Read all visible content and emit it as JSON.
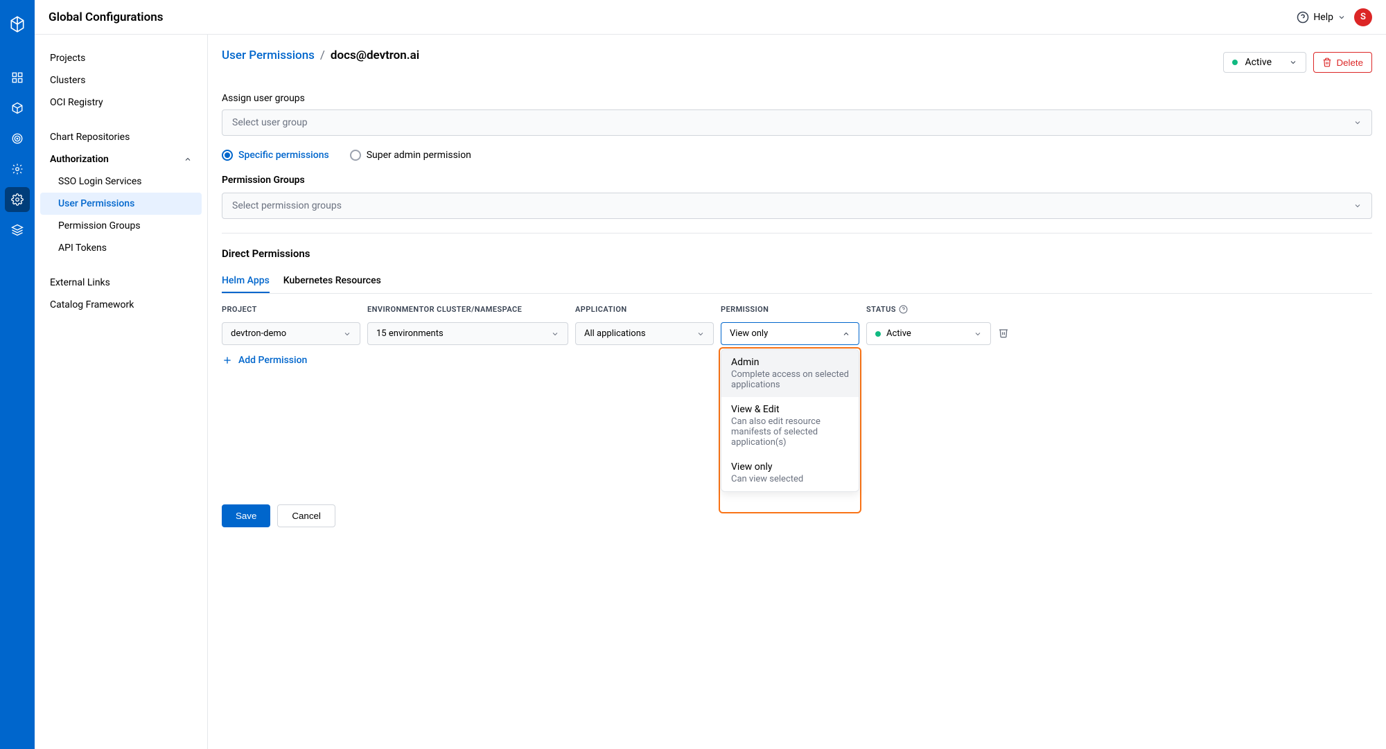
{
  "topbar": {
    "title": "Global Configurations",
    "help": "Help",
    "avatar": "S"
  },
  "sidebar": {
    "items": [
      {
        "label": "Projects"
      },
      {
        "label": "Clusters"
      },
      {
        "label": "OCI Registry"
      },
      {
        "label": "Chart Repositories"
      }
    ],
    "authorization": {
      "label": "Authorization",
      "children": [
        {
          "label": "SSO Login Services"
        },
        {
          "label": "User Permissions",
          "selected": true
        },
        {
          "label": "Permission Groups"
        },
        {
          "label": "API Tokens"
        }
      ]
    },
    "tail": [
      {
        "label": "External Links"
      },
      {
        "label": "Catalog Framework"
      }
    ]
  },
  "breadcrumb": {
    "link": "User Permissions",
    "current": "docs@devtron.ai"
  },
  "header_actions": {
    "status": "Active",
    "delete": "Delete"
  },
  "assign_groups": {
    "label": "Assign user groups",
    "placeholder": "Select user group"
  },
  "perm_radio": {
    "specific": "Specific permissions",
    "super": "Super admin permission"
  },
  "perm_groups": {
    "label": "Permission Groups",
    "placeholder": "Select permission groups"
  },
  "direct": {
    "title": "Direct Permissions"
  },
  "tabs": {
    "helm": "Helm Apps",
    "k8s": "Kubernetes Resources"
  },
  "columns": {
    "project": "PROJECT",
    "env": "ENVIRONMENTOR CLUSTER/NAMESPACE",
    "app": "APPLICATION",
    "perm": "PERMISSION",
    "status": "STATUS"
  },
  "row": {
    "project": "devtron-demo",
    "env": "15 environments",
    "app": "All applications",
    "perm": "View only",
    "status": "Active"
  },
  "add_perm": "Add Permission",
  "dropdown": [
    {
      "title": "Admin",
      "desc": "Complete access on selected applications",
      "hovered": true
    },
    {
      "title": "View & Edit",
      "desc": "Can also edit resource manifests of selected application(s)"
    },
    {
      "title": "View only",
      "desc": "Can view selected"
    }
  ],
  "footer": {
    "save": "Save",
    "cancel": "Cancel"
  }
}
